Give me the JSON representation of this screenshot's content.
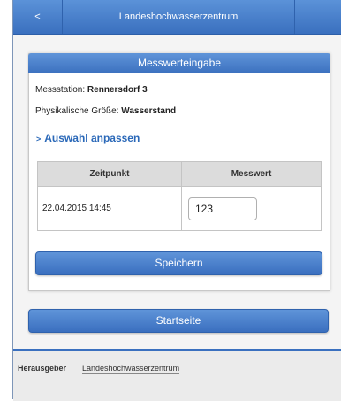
{
  "header": {
    "back_label": "<",
    "title": "Landeshochwasserzentrum"
  },
  "card": {
    "title": "Messwerteingabe",
    "station_label": "Messstation:",
    "station_value": "Rennersdorf 3",
    "quantity_label": "Physikalische Größe:",
    "quantity_value": "Wasserstand",
    "adjust_chevron": ">",
    "adjust_link": "Auswahl anpassen",
    "table": {
      "columns": [
        "Zeitpunkt",
        "Messwert"
      ],
      "rows": [
        {
          "time": "22.04.2015 14:45",
          "value": "123"
        }
      ]
    },
    "save_button": "Speichern"
  },
  "home_button": "Startseite",
  "footer": {
    "label": "Herausgeber",
    "link": "Landeshochwasserzentrum"
  },
  "colors": {
    "accent": "#3d72c0",
    "link": "#2a68b8",
    "table_header": "#dcdcdc"
  }
}
